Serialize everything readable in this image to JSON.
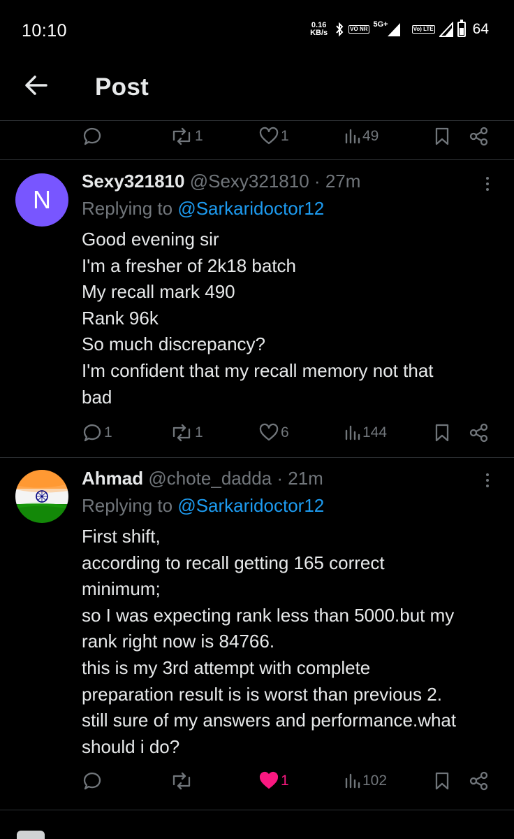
{
  "status_bar": {
    "time": "10:10",
    "speed_value": "0.16",
    "speed_unit": "KB/s",
    "vo_nr": "VO NR",
    "net_label": "5G+",
    "lte_chip": "Vo) LTE",
    "battery": "64"
  },
  "header": {
    "title": "Post"
  },
  "top_actions": {
    "reply_count": "",
    "repost_count": "1",
    "like_count": "1",
    "view_count": "49"
  },
  "replies": [
    {
      "avatar_letter": "N",
      "avatar_color": "#7856ff",
      "name": "Sexy321810",
      "handle": "@Sexy321810",
      "time": "27m",
      "replying_prefix": "Replying to",
      "replying_to": "@Sarkaridoctor12",
      "lines": [
        "Good evening sir",
        "I'm a fresher of 2k18 batch",
        "My recall mark 490",
        "Rank 96k",
        "So much discrepancy?",
        "I'm confident that my recall memory not that",
        "bad"
      ],
      "reply_count": "1",
      "repost_count": "1",
      "like_count": "6",
      "view_count": "144",
      "liked": false
    },
    {
      "avatar_letter": "",
      "avatar_color": "#ff9933",
      "name": "Ahmad",
      "handle": "@chote_dadda",
      "time": "21m",
      "replying_prefix": "Replying to",
      "replying_to": "@Sarkaridoctor12",
      "lines": [
        "First shift,",
        "according to recall getting 165 correct",
        "minimum;",
        "so I was expecting rank less than 5000.but my",
        "rank right now is 84766.",
        "this is my 3rd attempt with complete",
        "preparation result is is worst than previous 2.",
        "still sure of my answers and performance.what",
        "should i do?"
      ],
      "reply_count": "",
      "repost_count": "",
      "like_count": "1",
      "view_count": "102",
      "liked": true
    }
  ],
  "colors": {
    "background": "#000000",
    "text": "#e7e9ea",
    "muted": "#71767b",
    "link": "#1d9bf0",
    "like": "#f91880",
    "divider": "#2f3336"
  },
  "icons": {
    "back": "arrow-left-icon",
    "reply": "reply-bubble-icon",
    "repost": "repost-icon",
    "like": "heart-icon",
    "views": "views-chart-icon",
    "bookmark": "bookmark-icon",
    "share": "share-icon",
    "more": "more-vertical-icon"
  }
}
